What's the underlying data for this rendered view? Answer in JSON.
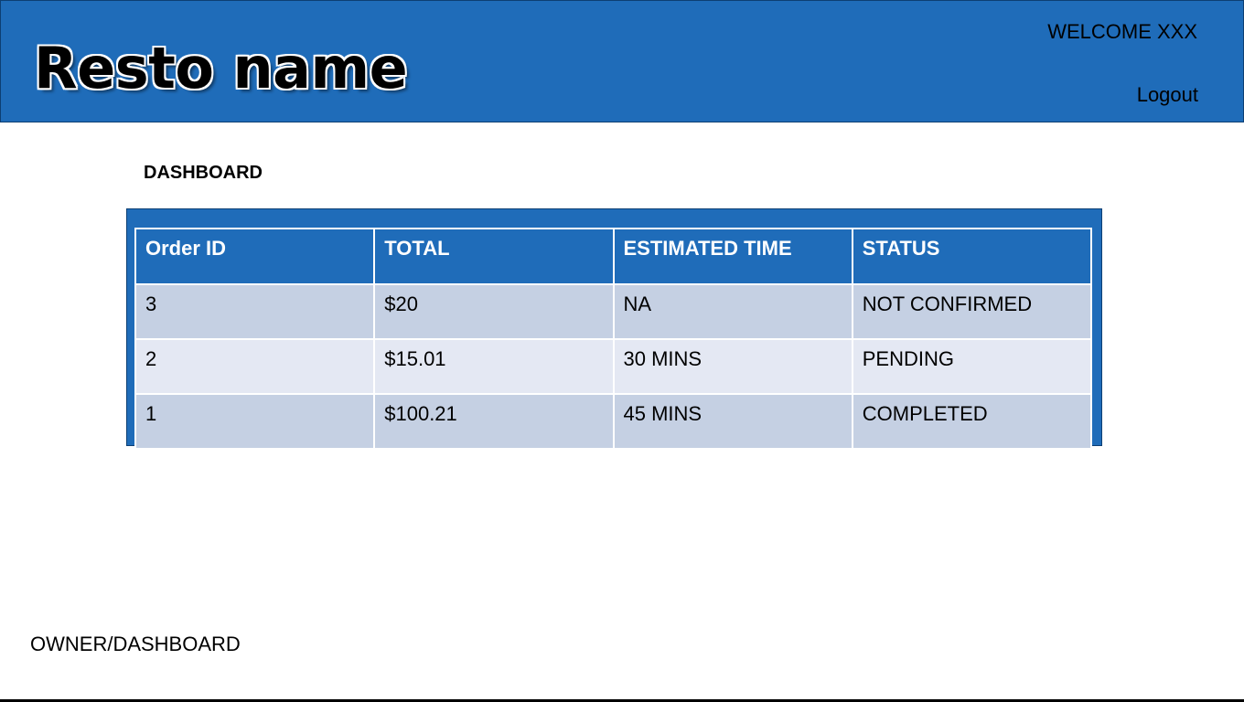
{
  "header": {
    "brand": "Resto name",
    "welcome": "WELCOME XXX",
    "logout": "Logout",
    "color": "#1f6cb9"
  },
  "main": {
    "title": "DASHBOARD",
    "table": {
      "columns": [
        "Order ID",
        "TOTAL",
        "ESTIMATED TIME",
        "STATUS"
      ],
      "rows": [
        [
          "3",
          "$20",
          "NA",
          "NOT CONFIRMED"
        ],
        [
          "2",
          "$15.01",
          "30 MINS",
          "PENDING"
        ],
        [
          "1",
          "$100.21",
          "45 MINS",
          "COMPLETED"
        ]
      ]
    }
  },
  "footer": {
    "route": "OWNER/DASHBOARD"
  }
}
